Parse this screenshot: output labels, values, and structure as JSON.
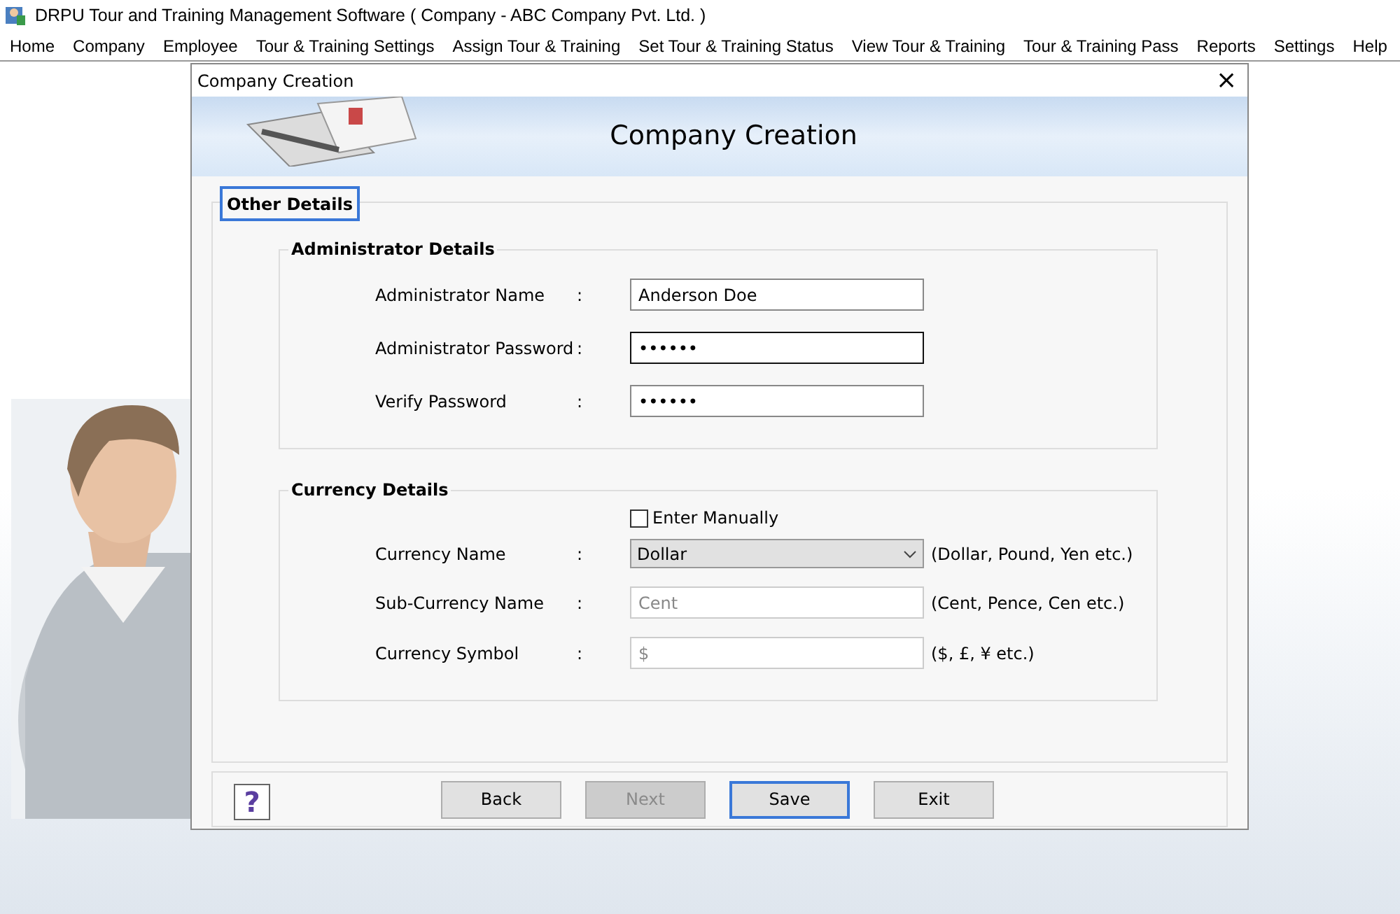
{
  "app_title": "DRPU Tour and Training Management Software ( Company - ABC Company Pvt. Ltd. )",
  "menu": [
    "Home",
    "Company",
    "Employee",
    "Tour & Training Settings",
    "Assign Tour & Training",
    "Set Tour & Training Status",
    "View Tour & Training",
    "Tour & Training Pass",
    "Reports",
    "Settings",
    "Help"
  ],
  "dialog": {
    "title": "Company Creation",
    "close": "×",
    "banner_title": "Company Creation",
    "tab": {
      "label": "Other Details",
      "selected": true
    },
    "sections": [
      {
        "title": "Administrator Details",
        "rows": [
          {
            "kind": "text",
            "label": "Administrator Name",
            "colon": ":",
            "value": "Anderson Doe",
            "focused": false
          },
          {
            "kind": "text",
            "label": "Administrator Password",
            "colon": ":",
            "value": "••••••",
            "focused": true
          },
          {
            "kind": "text",
            "label": "Verify Password",
            "colon": ":",
            "value": "••••••",
            "focused": false
          }
        ]
      },
      {
        "title": "Currency Details",
        "checkbox": {
          "label": "Enter Manually",
          "checked": false
        },
        "rows": [
          {
            "kind": "select",
            "label": "Currency Name",
            "colon": ":",
            "value": "Dollar",
            "hint": "(Dollar, Pound, Yen etc.)"
          },
          {
            "kind": "text",
            "label": "Sub-Currency Name",
            "colon": ":",
            "placeholder": "Cent",
            "hint": "(Cent, Pence, Cen etc.)",
            "focused": false
          },
          {
            "kind": "text",
            "label": "Currency Symbol",
            "colon": ":",
            "placeholder": "$",
            "hint": "($, £, ¥ etc.)",
            "focused": false
          }
        ]
      }
    ],
    "help": "?",
    "buttons": [
      {
        "label": "Back",
        "disabled": false,
        "focused": false
      },
      {
        "label": "Next",
        "disabled": true,
        "focused": false
      },
      {
        "label": "Save",
        "disabled": false,
        "focused": true
      },
      {
        "label": "Exit",
        "disabled": false,
        "focused": false
      }
    ]
  }
}
